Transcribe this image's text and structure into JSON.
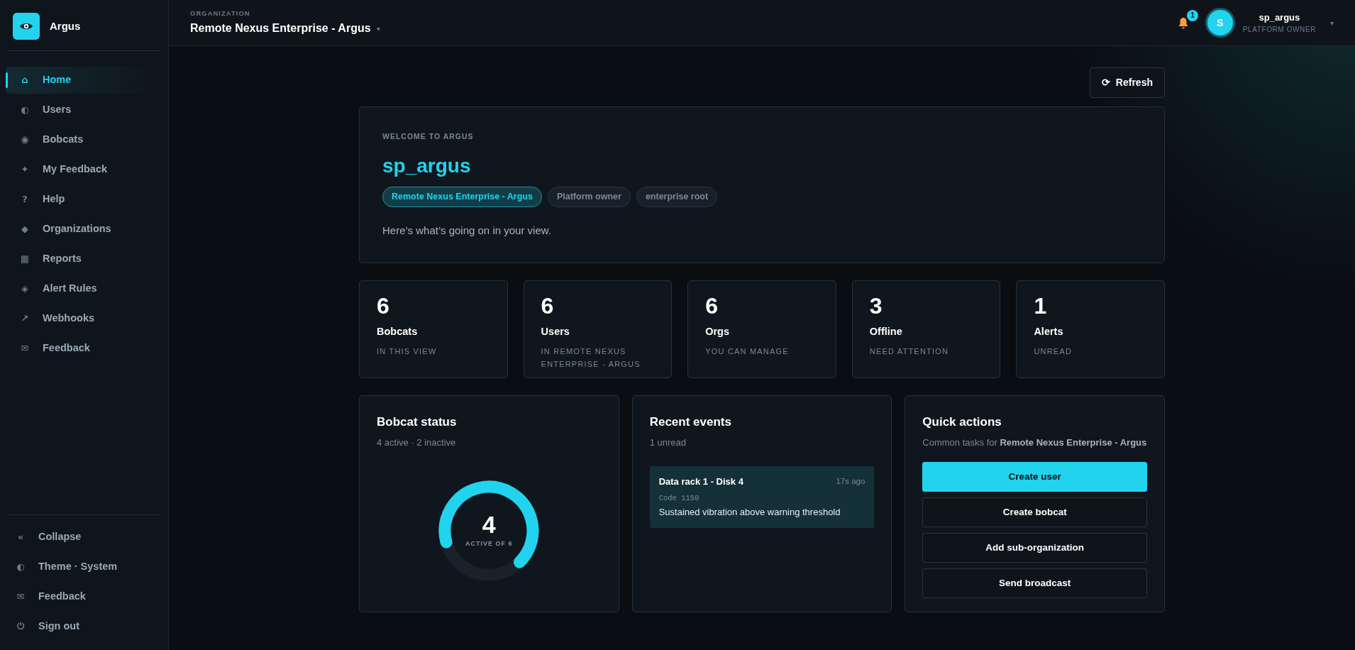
{
  "brand": {
    "name": "Argus"
  },
  "sidebar": {
    "items": [
      {
        "icon": "⌂",
        "label": "Home",
        "selected": true
      },
      {
        "icon": "◐",
        "label": "Users",
        "selected": false
      },
      {
        "icon": "◉",
        "label": "Bobcats",
        "selected": false
      },
      {
        "icon": "✦",
        "label": "My Feedback",
        "selected": false
      },
      {
        "icon": "?",
        "label": "Help",
        "selected": false
      },
      {
        "icon": "◆",
        "label": "Organizations",
        "selected": false
      },
      {
        "icon": "▦",
        "label": "Reports",
        "selected": false
      },
      {
        "icon": "◈",
        "label": "Alert Rules",
        "selected": false
      },
      {
        "icon": "↗",
        "label": "Webhooks",
        "selected": false
      },
      {
        "icon": "✉",
        "label": "Feedback",
        "selected": false
      }
    ],
    "footer_items": [
      {
        "icon": "«",
        "label": "Collapse"
      },
      {
        "icon": "◐",
        "label": "Theme · System"
      },
      {
        "icon": "✉",
        "label": "Feedback"
      },
      {
        "icon": "⏻",
        "label": "Sign out"
      }
    ]
  },
  "header": {
    "org_label": "ORGANIZATION",
    "org_name": "Remote Nexus Enterprise - Argus",
    "org_caret": "▾",
    "notifications": "1",
    "avatar": "S",
    "user": "sp_argus",
    "role": "PLATFORM OWNER",
    "user_caret": "▾"
  },
  "refresh": {
    "icon": "⟳",
    "label": "Refresh"
  },
  "welcome": {
    "eyebrow": "WELCOME TO ARGUS",
    "name": "sp_argus",
    "tags": [
      {
        "label": "Remote Nexus Enterprise - Argus",
        "selected": true
      },
      {
        "label": "Platform owner",
        "selected": false
      },
      {
        "label": "enterprise root",
        "selected": false
      }
    ],
    "message": "Here’s what’s going on in your view."
  },
  "stats": [
    {
      "value": "6",
      "label": "Bobcats",
      "sub": "IN THIS VIEW"
    },
    {
      "value": "6",
      "label": "Users",
      "sub": "IN REMOTE NEXUS ENTERPRISE - ARGUS"
    },
    {
      "value": "6",
      "label": "Orgs",
      "sub": "YOU CAN MANAGE"
    },
    {
      "value": "3",
      "label": "Offline",
      "sub": "NEED ATTENTION"
    },
    {
      "value": "1",
      "label": "Alerts",
      "sub": "UNREAD"
    }
  ],
  "bobcat_status": {
    "title": "Bobcat status",
    "subtitle": "4 active · 2 inactive",
    "level": 0.667,
    "center_value": "4",
    "center_label": "ACTIVE OF 6"
  },
  "recent_events": {
    "title": "Recent events",
    "subtitle": "1 unread",
    "events": [
      {
        "title": "Data rack 1 - Disk 4",
        "time": "17s ago",
        "code": "Code 1150",
        "message": "Sustained vibration above warning threshold"
      }
    ]
  },
  "quick_actions": {
    "title": "Quick actions",
    "subtitle": "Common tasks for **Remote Nexus Enterprise - Argus**",
    "actions": [
      {
        "label": "Create user",
        "kind": "primary"
      },
      {
        "label": "Create bobcat",
        "kind": "outline"
      },
      {
        "label": "Add sub-organization",
        "kind": "outline"
      },
      {
        "label": "Send broadcast",
        "kind": "outline"
      }
    ]
  }
}
